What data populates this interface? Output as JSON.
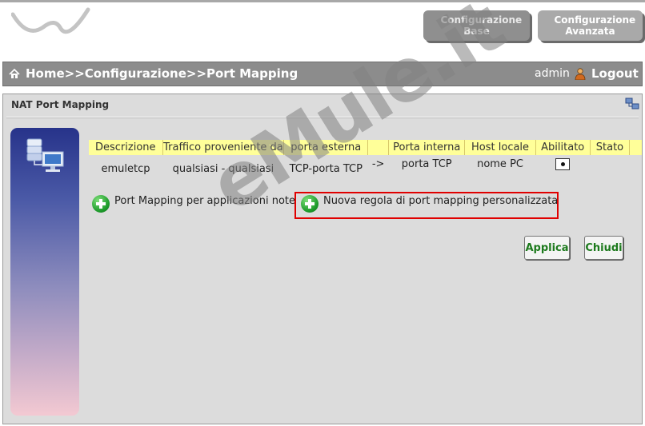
{
  "header": {
    "tab_base": "Configurazione Base",
    "tab_advanced": "Configurazione Avanzata"
  },
  "breadcrumb": {
    "text": "Home>>Configurazione>>Port Mapping",
    "user": "admin",
    "logout": "Logout"
  },
  "panel": {
    "title": "NAT Port Mapping"
  },
  "table": {
    "columns": [
      "Descrizione",
      "Traffico proveniente da",
      "porta esterna",
      "",
      "Porta interna",
      "Host locale",
      "Abilitato",
      "Stato"
    ],
    "rows": [
      {
        "descrizione": "emuletcp",
        "traffico": "qualsiasi - qualsiasi",
        "porta_esterna": "TCP-porta TCP",
        "arrow": "->",
        "porta_interna": "porta TCP",
        "host_locale": "nome PC",
        "abilitato": true,
        "stato": ""
      }
    ]
  },
  "actions": {
    "known_apps": "Port Mapping per applicazioni note",
    "new_rule": "Nuova regola di port mapping personalizzata"
  },
  "buttons": {
    "apply": "Applica",
    "close": "Chiudi"
  },
  "watermark": "eMule.it",
  "colors": {
    "highlight": "#e00000",
    "table_header": "#ffff99",
    "button_text": "#1d7a1d"
  }
}
